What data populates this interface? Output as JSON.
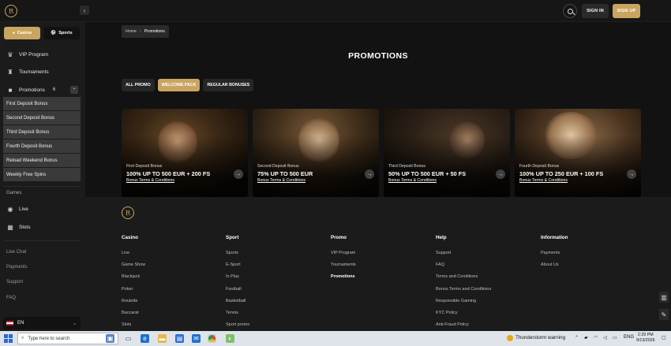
{
  "header": {
    "logo_text": "R",
    "collapse_glyph": "‹",
    "signin_label": "SIGN IN",
    "signup_label": "SIGN UP"
  },
  "sidebar": {
    "modes": {
      "casino": "Casino",
      "sports": "Sports"
    },
    "links": {
      "vip": "VIP Program",
      "tournaments": "Tournaments",
      "promotions": "Promotions",
      "promotions_count": "6"
    },
    "promo_sub": [
      "First Deposit Bonus",
      "Second Deposit Bonus",
      "Third Deposit Bonus",
      "Fourth Deposit Bonus",
      "Reload Weekend Bonus",
      "Weekly Free Spins"
    ],
    "games_label": "Games",
    "games": {
      "live": "Live",
      "slots": "Slots"
    },
    "misc": {
      "live_chat": "Live Chat",
      "payments": "Payments",
      "support": "Support",
      "faq": "FAQ"
    },
    "language": "EN"
  },
  "breadcrumb": {
    "home": "Home",
    "current": "Promotions"
  },
  "page_title": "PROMOTIONS",
  "filters": {
    "all": "ALL PROMO",
    "welcome": "WELCOME PACK",
    "regular": "REGULAR BONUSES",
    "active": "welcome"
  },
  "cards": [
    {
      "subtitle": "First Deposit Bonus",
      "headline": "100% UP TO 500 EUR + 200 FS",
      "terms": "Bonus Terms & Conditions"
    },
    {
      "subtitle": "Second Deposit Bonus",
      "headline": "75% UP TO 500 EUR",
      "terms": "Bonus Terms & Conditions"
    },
    {
      "subtitle": "Third Deposit Bonus",
      "headline": "50% UP TO 500 EUR + 50 FS",
      "terms": "Bonus Terms & Conditions"
    },
    {
      "subtitle": "Fourth Deposit Bonus",
      "headline": "100% UP TO 250 EUR + 100 FS",
      "terms": "Bonus Terms & Conditions"
    }
  ],
  "footer": {
    "logo_text": "R",
    "casino": {
      "title": "Casino",
      "links": [
        "Live",
        "Game Show",
        "Blackjack",
        "Poker",
        "Roulette",
        "Baccarat",
        "Slots"
      ]
    },
    "sport": {
      "title": "Sport",
      "links": [
        "Sports",
        "E-Sport",
        "In Play",
        "Football",
        "Basketball",
        "Tennis",
        "Sport promo"
      ]
    },
    "promo": {
      "title": "Promo",
      "links": [
        "VIP Program",
        "Tournaments",
        "Promotions"
      ]
    },
    "help": {
      "title": "Help",
      "links": [
        "Support",
        "FAQ",
        "Terms and Conditions",
        "Bonus Terms and Conditions",
        "Responsible Gaming",
        "KYC Policy",
        "Anti-Fraud Policy"
      ]
    },
    "information": {
      "title": "Information",
      "links": [
        "Payments",
        "About Us"
      ]
    }
  },
  "taskbar": {
    "search_placeholder": "Type here to search",
    "weather": "Thunderstorm warning",
    "lang": "ENG",
    "time": "2:29 PM",
    "date": "9/13/2026"
  }
}
